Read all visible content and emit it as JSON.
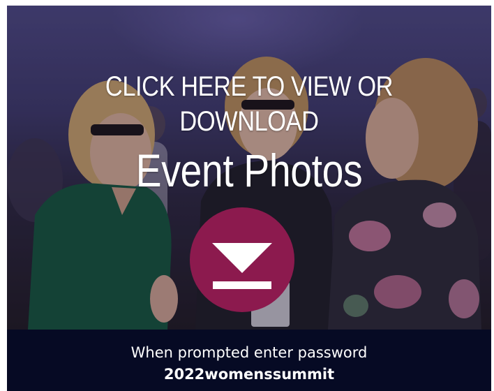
{
  "banner": {
    "headline_line1": "CLICK HERE TO VIEW OR",
    "headline_line2": "DOWNLOAD",
    "headline_big": "Event Photos",
    "download_icon": "download-arrow-icon",
    "background_image": "women-talking-at-event-photo",
    "accent_color": "#8c1a4e"
  },
  "footer": {
    "prompt": "When prompted enter password",
    "password": "2022womenssummit",
    "background_color": "#060a24"
  }
}
